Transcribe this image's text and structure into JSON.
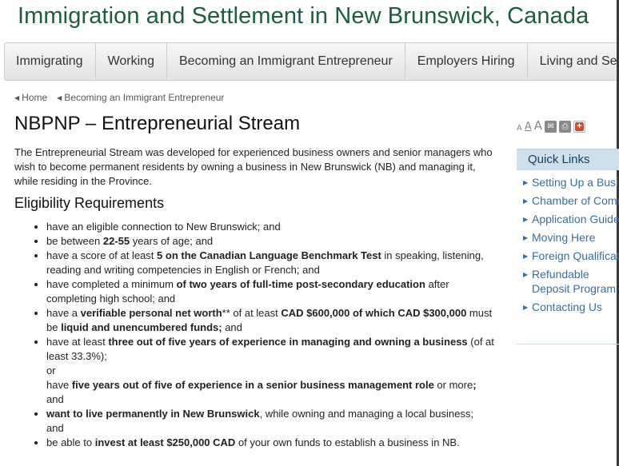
{
  "site": {
    "title": "Immigration and Settlement in New Brunswick, Canada"
  },
  "nav": [
    {
      "label": "Immigrating"
    },
    {
      "label": "Working"
    },
    {
      "label": "Becoming an Immigrant Entrepreneur"
    },
    {
      "label": "Employers Hiring"
    },
    {
      "label": "Living and Settling"
    }
  ],
  "breadcrumb": [
    {
      "label": "Home"
    },
    {
      "label": "Becoming an Immigrant Entrepreneur"
    }
  ],
  "page": {
    "title": "NBPNP – Entrepreneurial Stream",
    "intro": "The Entrepreneurial Stream was developed for experienced business owners and senior managers who wish to become permanent residents by owning a business in New Brunswick (NB) and managing it, while residing in the Province.",
    "section_heading": "Eligibility Requirements"
  },
  "tools": {
    "font_small": "A",
    "font_medium": "A",
    "font_large": "A",
    "email_icon": "envelope-icon",
    "print_icon": "printer-icon",
    "share_icon": "plus-icon"
  },
  "requirements": {
    "r1": "have an eligible connection to New Brunswick; and",
    "r2_a": "be between ",
    "r2_b": "22-55",
    "r2_c": " years of age; and",
    "r3_a": "have a score of at least ",
    "r3_b": "5 on the Canadian Language Benchmark Test",
    "r3_c": " in speaking, listening, reading and writing competencies in English or French; and",
    "r4_a": "have completed a minimum ",
    "r4_b": "of two years of full-time post-secondary education",
    "r4_c": " after completing high school; and",
    "r5_a": "have a ",
    "r5_b": "verifiable personal net worth",
    "r5_c": "** of at least ",
    "r5_d": "CAD $600,000 of which CAD $300,000",
    "r5_e": " must be ",
    "r5_f": "liquid and unencumbered funds;",
    "r5_g": " and",
    "r6_a": "have at least ",
    "r6_b": "three out of five years of experience in  managing and owning a business",
    "r6_c": " (of at least 33.3%);",
    "r6_or": "or",
    "r6_d": "have ",
    "r6_e": "five years out of five of experience in a senior business management role",
    "r6_f": " or more",
    "r6_g": ";",
    "r6_and": "and",
    "r7_a": "want to live permanently in New Brunswick",
    "r7_b": ", while owning and  managing a local business;",
    "r7_and": "and",
    "r8_a": "be able to ",
    "r8_b": "invest at least $250,000 CAD",
    "r8_c": " of your own funds to establish a business in NB."
  },
  "quick_links": {
    "title": "Quick Links",
    "items": [
      {
        "label": "Setting Up a Business"
      },
      {
        "label": "Chamber of Commerce"
      },
      {
        "label": "Application Guides"
      },
      {
        "label": "Moving Here"
      },
      {
        "label": "Foreign Qualifications"
      },
      {
        "label": "Refundable Deposit Program"
      },
      {
        "label": "Contacting Us"
      }
    ]
  }
}
